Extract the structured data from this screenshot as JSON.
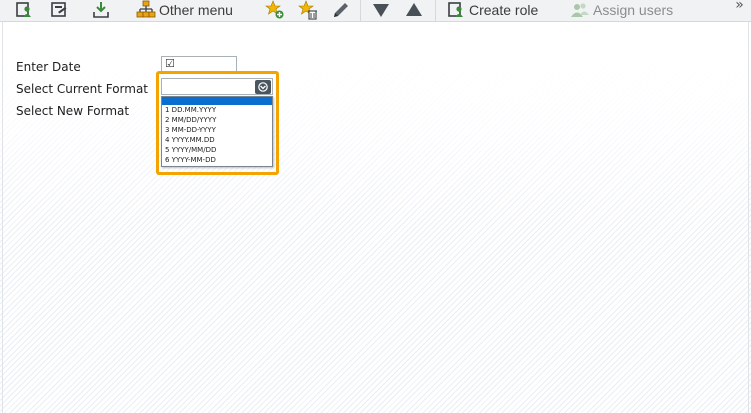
{
  "toolbar": {
    "icons": [
      "display-role-icon",
      "change-role-icon",
      "transport-icon",
      "other-menu-icon",
      "add-favorite-icon",
      "delete-favorite-icon",
      "edit-pencil-icon",
      "move-down-icon",
      "move-up-icon",
      "create-role-icon",
      "assign-users-icon"
    ],
    "other_menu_label": "Other menu",
    "create_role_label": "Create role",
    "assign_users_label": "Assign users",
    "more_glyph": "»",
    "accent": "#2a7fc1",
    "green": "#3a8a3a"
  },
  "form": {
    "enter_date_label": "Enter Date",
    "enter_date_checked": "☑",
    "current_format_label": "Select Current Format",
    "current_format_value": "",
    "new_format_label": "Select New Format"
  },
  "dropdown": {
    "options": [
      "1 DD.MM.YYYY",
      "2 MM/DD/YYYY",
      "3 MM-DD-YYYY",
      "4 YYYY.MM.DD",
      "5 YYYY/MM/DD",
      "6 YYYY-MM-DD"
    ],
    "highlight_color": "#f5a300",
    "selection_color": "#0a6ed1"
  }
}
